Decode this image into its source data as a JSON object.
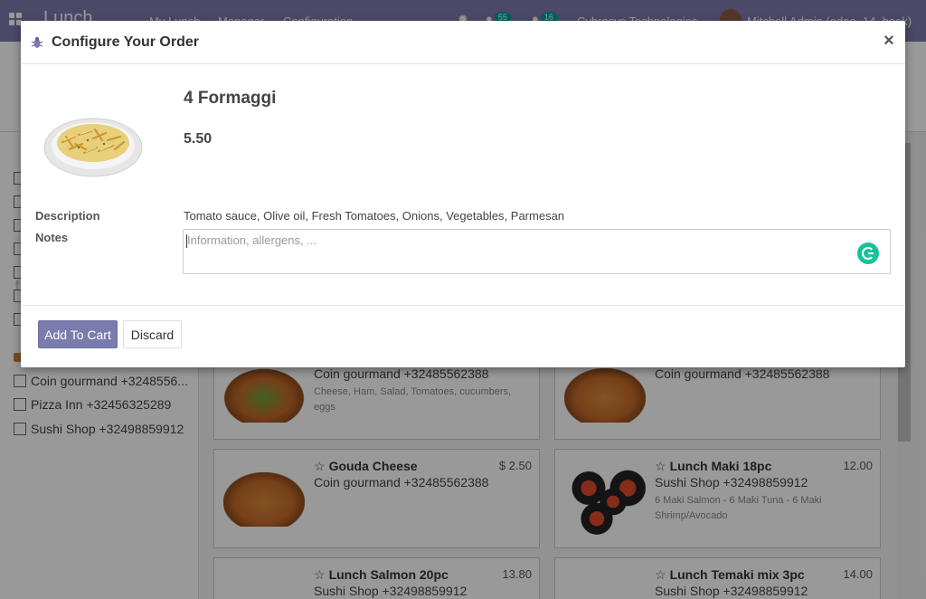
{
  "app": {
    "brand": "Lunch",
    "menu": [
      "My Lunch",
      "Manager",
      "Configuration"
    ],
    "chat_count": "55",
    "activity_count": "16",
    "company": "Cybrosys Technologies",
    "user": "Mitchell Admin (odoo_14_book)"
  },
  "sidebar": {
    "vendors": [
      {
        "label": "Coin gourmand +3248556..."
      },
      {
        "label": "Pizza Inn +32456325289"
      },
      {
        "label": "Sushi Shop +32498859912"
      }
    ]
  },
  "products": [
    {
      "name": "",
      "vendor": "Coin gourmand +32485562388",
      "description": "Cheese, Ham, Salad, Tomatoes, cucumbers, eggs",
      "price": ""
    },
    {
      "name": "",
      "vendor": "Coin gourmand +32485562388",
      "description": "",
      "price": ""
    },
    {
      "name": "Gouda Cheese",
      "vendor": "Coin gourmand +32485562388",
      "description": "",
      "price": "$ 2.50"
    },
    {
      "name": "Lunch Maki 18pc",
      "vendor": "Sushi Shop +32498859912",
      "description": "6 Maki Salmon - 6 Maki Tuna - 6 Maki Shrimp/Avocado",
      "price": "12.00"
    },
    {
      "name": "Lunch Salmon 20pc",
      "vendor": "Sushi Shop +32498859912",
      "description": "",
      "price": "13.80"
    },
    {
      "name": "Lunch Temaki mix 3pc",
      "vendor": "Sushi Shop +32498859912",
      "description": "",
      "price": "14.00"
    }
  ],
  "modal": {
    "title": "Configure Your Order",
    "close": "×",
    "product_name": "4 Formaggi",
    "product_price": "5.50",
    "description_label": "Description",
    "description_value": "Tomato sauce, Olive oil, Fresh Tomatoes, Onions, Vegetables, Parmesan",
    "notes_label": "Notes",
    "notes_placeholder": "Information, allergens, ...",
    "add_button": "Add To Cart",
    "discard_button": "Discard"
  },
  "colors": {
    "brand": "#7c7bad",
    "grammarly": "#15c39a"
  }
}
